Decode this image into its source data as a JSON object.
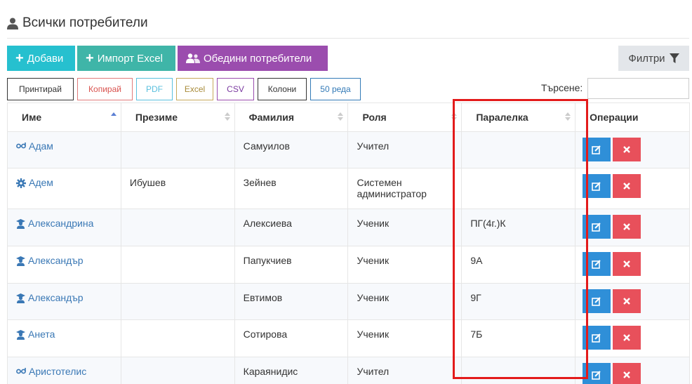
{
  "page": {
    "title": "Всички потребители",
    "icon": "user-icon"
  },
  "toolbar": {
    "add_label": "Добави",
    "import_label": "Импорт Excel",
    "merge_label": "Обедини потребители",
    "filter_label": "Филтри"
  },
  "export": {
    "print": "Принтирай",
    "copy": "Копирай",
    "pdf": "PDF",
    "excel": "Excel",
    "csv": "CSV",
    "columns": "Колони",
    "rows": "50 реда"
  },
  "search": {
    "label": "Търсене:",
    "value": ""
  },
  "table": {
    "headers": [
      "Име",
      "Презиме",
      "Фамилия",
      "Роля",
      "Паралелка",
      "Операции"
    ],
    "rows": [
      {
        "name": "Адам",
        "icon": "teacher-icon",
        "middle": "",
        "last": "Самуилов",
        "role": "Учител",
        "class": ""
      },
      {
        "name": "Адем",
        "icon": "gear-icon",
        "middle": "Ибушев",
        "last": "Зейнев",
        "role": "Системен администратор",
        "class": ""
      },
      {
        "name": "Александрина",
        "icon": "student-icon",
        "middle": "",
        "last": "Алексиева",
        "role": "Ученик",
        "class": "ПГ(4г.)К"
      },
      {
        "name": "Александър",
        "icon": "student-icon",
        "middle": "",
        "last": "Папукчиев",
        "role": "Ученик",
        "class": "9А"
      },
      {
        "name": "Александър",
        "icon": "student-icon",
        "middle": "",
        "last": "Евтимов",
        "role": "Ученик",
        "class": "9Г"
      },
      {
        "name": "Анета",
        "icon": "student-icon",
        "middle": "",
        "last": "Сотирова",
        "role": "Ученик",
        "class": "7Б"
      },
      {
        "name": "Аристотелис",
        "icon": "teacher-icon",
        "middle": "",
        "last": "Караянидис",
        "role": "Учител",
        "class": ""
      }
    ]
  },
  "colors": {
    "add": "#26c0cf",
    "import": "#3fb5a8",
    "merge": "#9b4dae",
    "edit": "#2f8fd8",
    "delete": "#e8505b",
    "highlight": "#e31b1b",
    "link": "#3a78b5"
  }
}
